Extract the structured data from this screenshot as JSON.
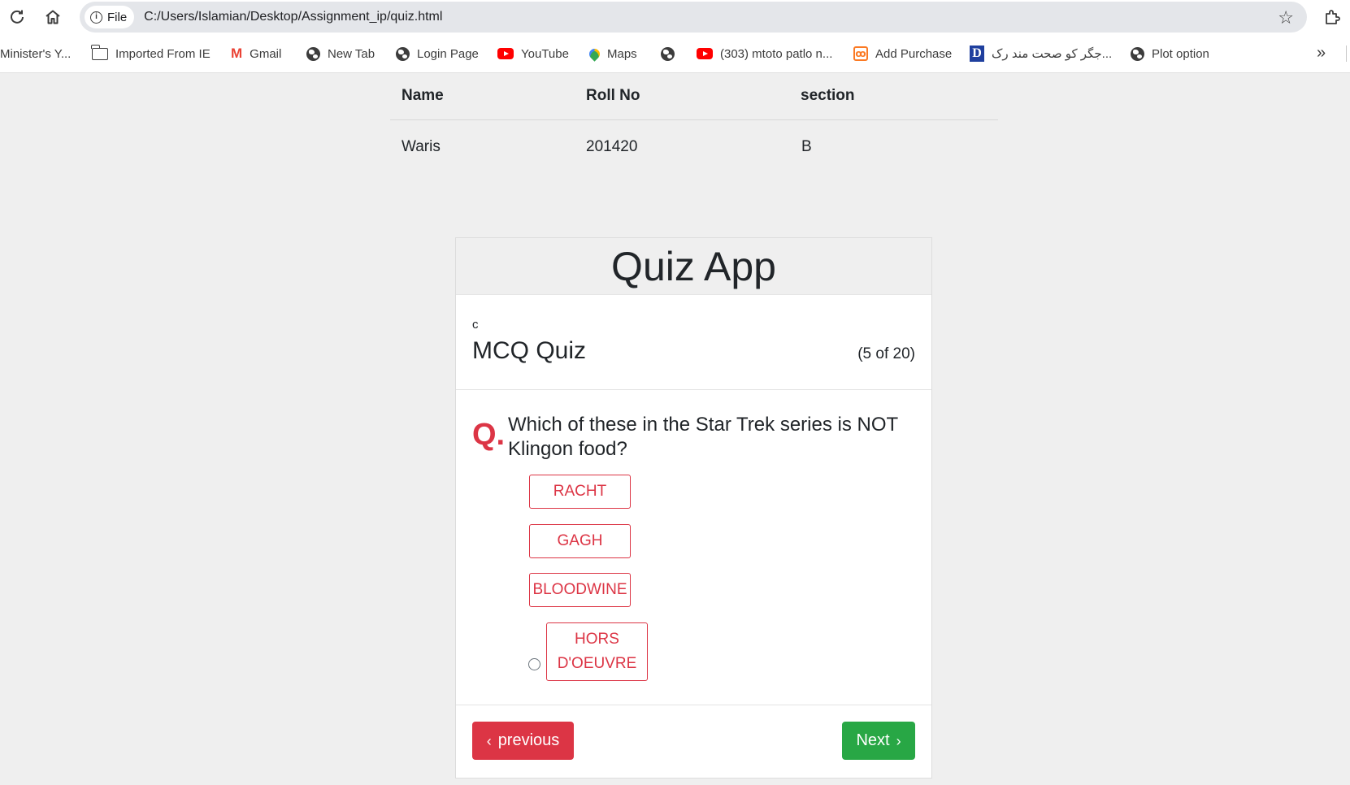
{
  "browser": {
    "file_label": "File",
    "url": "C:/Users/Islamian/Desktop/Assignment_ip/quiz.html",
    "bookmarks": [
      {
        "label": "Minister's Y...",
        "icon": "none"
      },
      {
        "label": "Imported From IE",
        "icon": "folder-icon"
      },
      {
        "label": "Gmail",
        "icon": "gmail-icon"
      },
      {
        "label": "New Tab",
        "icon": "globe-icon"
      },
      {
        "label": "Login Page",
        "icon": "globe-icon"
      },
      {
        "label": "YouTube",
        "icon": "youtube-icon"
      },
      {
        "label": "Maps",
        "icon": "maps-icon"
      },
      {
        "label": "",
        "icon": "globe-icon"
      },
      {
        "label": "(303) mtoto patlo n...",
        "icon": "youtube-icon"
      },
      {
        "label": "Add Purchase",
        "icon": "xampp-icon"
      },
      {
        "label": "جگر کو صحت مند رک...",
        "icon": "dictionary-icon"
      },
      {
        "label": "Plot option",
        "icon": "globe-icon"
      }
    ]
  },
  "student_table": {
    "headers": {
      "name": "Name",
      "roll": "Roll No",
      "section": "section"
    },
    "row": {
      "name": "Waris",
      "roll": "201420",
      "section": "B"
    }
  },
  "quiz": {
    "title": "Quiz App",
    "stray_text": "c",
    "subtitle": "MCQ Quiz",
    "progress": "(5 of 20)",
    "question_mark": "Q.",
    "question": "Which of these in the Star Trek series is NOT Klingon food?",
    "options": [
      "RACHT",
      "GAGH",
      "BLOODWINE",
      "HORS D'OEUVRE"
    ],
    "prev_label": "previous",
    "next_label": "Next"
  },
  "colors": {
    "accent_red": "#dc3545",
    "accent_green": "#28a745",
    "page_bg": "#efefef"
  }
}
